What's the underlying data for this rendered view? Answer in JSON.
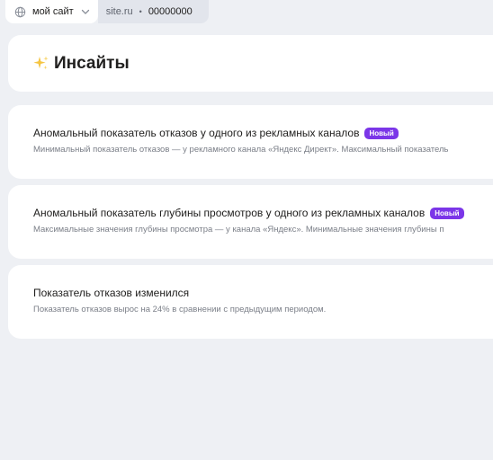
{
  "topbar": {
    "site_selector": "мой сайт",
    "site_domain": "site.ru",
    "separator": "•",
    "counter_id": "00000000"
  },
  "page": {
    "title": "Инсайты"
  },
  "insights": [
    {
      "title": "Аномальный показатель отказов у одного из рекламных каналов",
      "badge": "Новый",
      "description": "Минимальный показатель отказов — у рекламного канала «Яндекс Директ». Максимальный показатель"
    },
    {
      "title": "Аномальный показатель глубины просмотров у одного из рекламных каналов",
      "badge": "Новый",
      "description": "Максимальные значения глубины просмотра — у канала «Яндекс». Минимальные значения глубины п"
    },
    {
      "title": "Показатель отказов изменился",
      "description": "Показатель отказов вырос на 24% в сравнении с предыдущим периодом."
    }
  ],
  "colors": {
    "background": "#eef0f4",
    "badge": "#7b36e8",
    "sparkle": "#f5c542"
  },
  "icons": {
    "site_selector": "globe-icon",
    "dropdown": "chevron-down-icon",
    "title": "sparkles-icon"
  }
}
